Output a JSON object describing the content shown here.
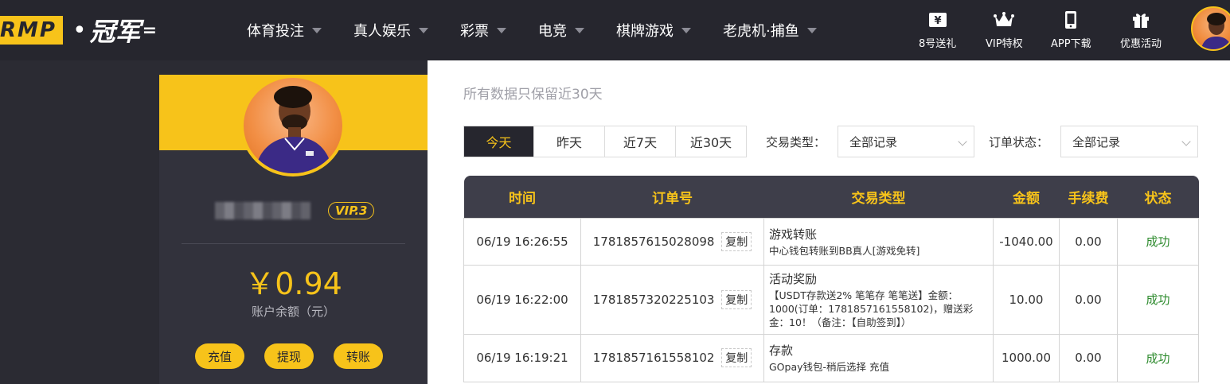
{
  "header": {
    "logo": {
      "box_text": "RMP",
      "name": "冠军",
      "tail": ""
    },
    "nav": [
      {
        "label": "体育投注"
      },
      {
        "label": "真人娱乐"
      },
      {
        "label": "彩票"
      },
      {
        "label": "电竞"
      },
      {
        "label": "棋牌游戏"
      },
      {
        "label": "老虎机·捕鱼"
      }
    ],
    "quick": [
      {
        "label": "8号送礼",
        "icon": "yen-ticket-icon"
      },
      {
        "label": "VIP特权",
        "icon": "crown-icon"
      },
      {
        "label": "APP下载",
        "icon": "phone-icon"
      },
      {
        "label": "优惠活动",
        "icon": "gift-icon"
      }
    ]
  },
  "profile": {
    "vip_level": "VIP.3",
    "balance": "￥0.94",
    "balance_label": "账户余额（元）",
    "actions": [
      {
        "label": "充值"
      },
      {
        "label": "提现"
      },
      {
        "label": "转账"
      }
    ]
  },
  "main": {
    "note": "所有数据只保留近30天",
    "date_tabs": [
      {
        "label": "今天",
        "active": true
      },
      {
        "label": "昨天",
        "active": false
      },
      {
        "label": "近7天",
        "active": false
      },
      {
        "label": "近30天",
        "active": false
      }
    ],
    "filters": {
      "type_label": "交易类型：",
      "type_value": "全部记录",
      "status_label": "订单状态：",
      "status_value": "全部记录"
    },
    "table": {
      "headers": [
        "时间",
        "订单号",
        "交易类型",
        "金额",
        "手续费",
        "状态"
      ],
      "copy_label": "复制",
      "rows": [
        {
          "time": "06/19 16:26:55",
          "order": "1781857615028098",
          "type_title": "游戏转账",
          "type_desc": "中心钱包转账到BB真人[游戏免转]",
          "amount": "-1040.00",
          "fee": "0.00",
          "status": "成功"
        },
        {
          "time": "06/19 16:22:00",
          "order": "1781857320225103",
          "type_title": "活动奖励",
          "type_desc": "【USDT存款送2% 笔笔存 笔笔送】金额：1000(订单：1781857161558102)，赠送彩金：10！（备注：【自助签到】）",
          "amount": "10.00",
          "fee": "0.00",
          "status": "成功"
        },
        {
          "time": "06/19 16:19:21",
          "order": "1781857161558102",
          "type_title": "存款",
          "type_desc": "GOpay钱包-稍后选择 充值",
          "amount": "1000.00",
          "fee": "0.00",
          "status": "成功"
        }
      ]
    }
  },
  "colors": {
    "accent": "#f7c31a",
    "nav_bg": "#26262e",
    "success": "#2e8b2e"
  }
}
